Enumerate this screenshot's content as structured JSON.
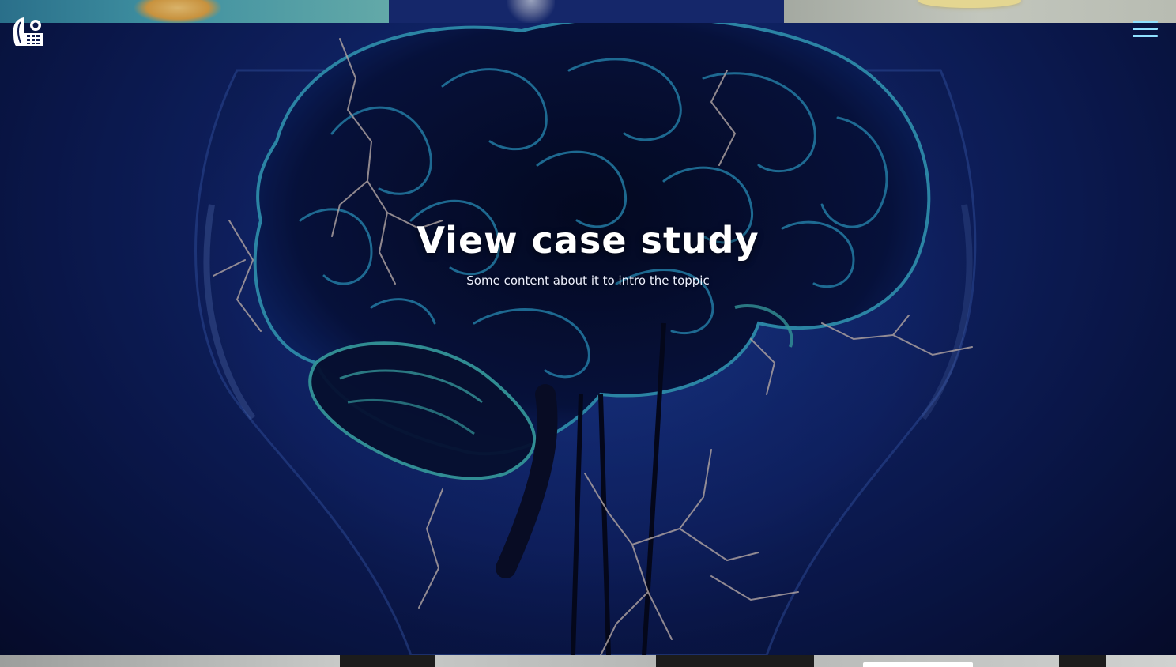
{
  "header": {
    "logo_icon": "brand-logo-icon",
    "menu_icon": "hamburger-menu-icon",
    "menu_color": "#8fe1ff"
  },
  "hero": {
    "title": "View case study",
    "subtitle": "Some content about it to intro the toppic",
    "image": "brain-in-lightbulb-image"
  },
  "colors": {
    "hero_blue": "#142c7d",
    "glow_teal": "#46c9c6",
    "text": "#ffffff"
  }
}
